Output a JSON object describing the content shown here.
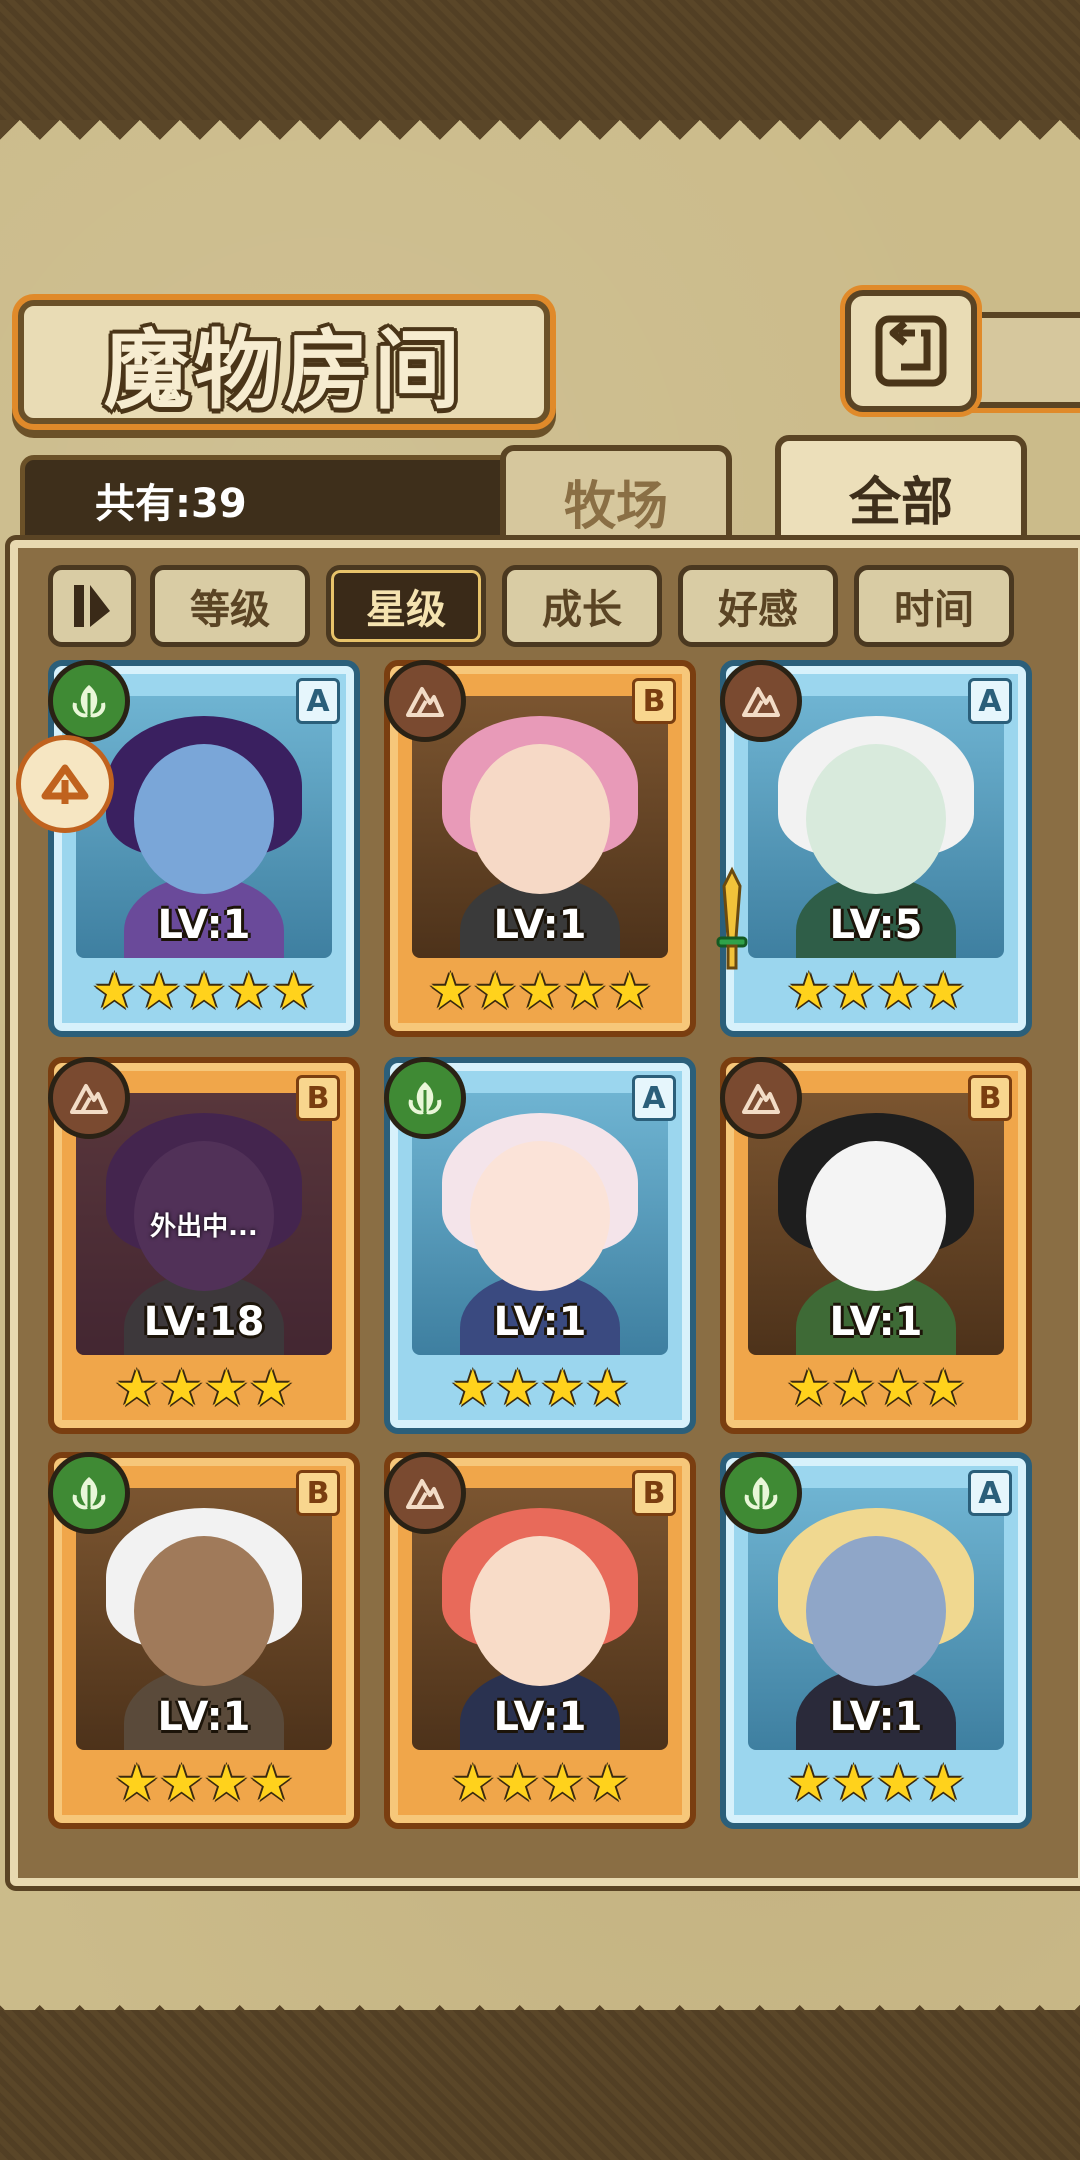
{
  "header": {
    "title": "魔物房间"
  },
  "summary": {
    "count_label": "共有:39"
  },
  "tabs": [
    {
      "label": "牧场",
      "active": false
    },
    {
      "label": "全部",
      "active": true
    }
  ],
  "filters": [
    {
      "label": "等级",
      "active": false
    },
    {
      "label": "星级",
      "active": true
    },
    {
      "label": "成长",
      "active": false
    },
    {
      "label": "好感",
      "active": false
    },
    {
      "label": "时间",
      "active": false
    }
  ],
  "colors": {
    "rarity_a": "#9bd6ee",
    "rarity_b": "#f0a64a",
    "nature_badge": "#3f8a34",
    "earth_badge": "#7a4a30",
    "star": "#ffd21c"
  },
  "cards": [
    {
      "rank": "A",
      "type": "nature-icon",
      "level": "LV:1",
      "stars": "★★★★★",
      "skin": "#7aa6d8",
      "hair": "#3a2060",
      "outfit": "#6a4a9a"
    },
    {
      "rank": "B",
      "type": "earth-icon",
      "level": "LV:1",
      "stars": "★★★★★",
      "skin": "#f6d9c6",
      "hair": "#e89ab8",
      "outfit": "#3a3a3a"
    },
    {
      "rank": "A",
      "type": "earth-icon",
      "level": "LV:5",
      "stars": "★★★★",
      "skin": "#d8eadc",
      "hair": "#f2f2f2",
      "outfit": "#2f5e48"
    },
    {
      "rank": "B",
      "type": "earth-icon",
      "level": "LV:18",
      "stars": "★★★★",
      "skin": "#6a4a70",
      "hair": "#4e2f5a",
      "outfit": "#3f5a30",
      "status": "外出中..."
    },
    {
      "rank": "A",
      "type": "nature-icon",
      "level": "LV:1",
      "stars": "★★★★",
      "skin": "#fbe3d8",
      "hair": "#f4e4ea",
      "outfit": "#3a4a80"
    },
    {
      "rank": "B",
      "type": "earth-icon",
      "level": "LV:1",
      "stars": "★★★★",
      "skin": "#f4f4f4",
      "hair": "#1e1e1e",
      "outfit": "#3e6a36"
    },
    {
      "rank": "B",
      "type": "nature-icon",
      "level": "LV:1",
      "stars": "★★★★",
      "skin": "#a07a5a",
      "hair": "#f2f2f2",
      "outfit": "#5a4a3a"
    },
    {
      "rank": "B",
      "type": "earth-icon",
      "level": "LV:1",
      "stars": "★★★★",
      "skin": "#f8dcc8",
      "hair": "#e86a5a",
      "outfit": "#2a3250"
    },
    {
      "rank": "A",
      "type": "nature-icon",
      "level": "LV:1",
      "stars": "★★★★",
      "skin": "#8fa6c8",
      "hair": "#f0d890",
      "outfit": "#2a2a3a"
    }
  ]
}
